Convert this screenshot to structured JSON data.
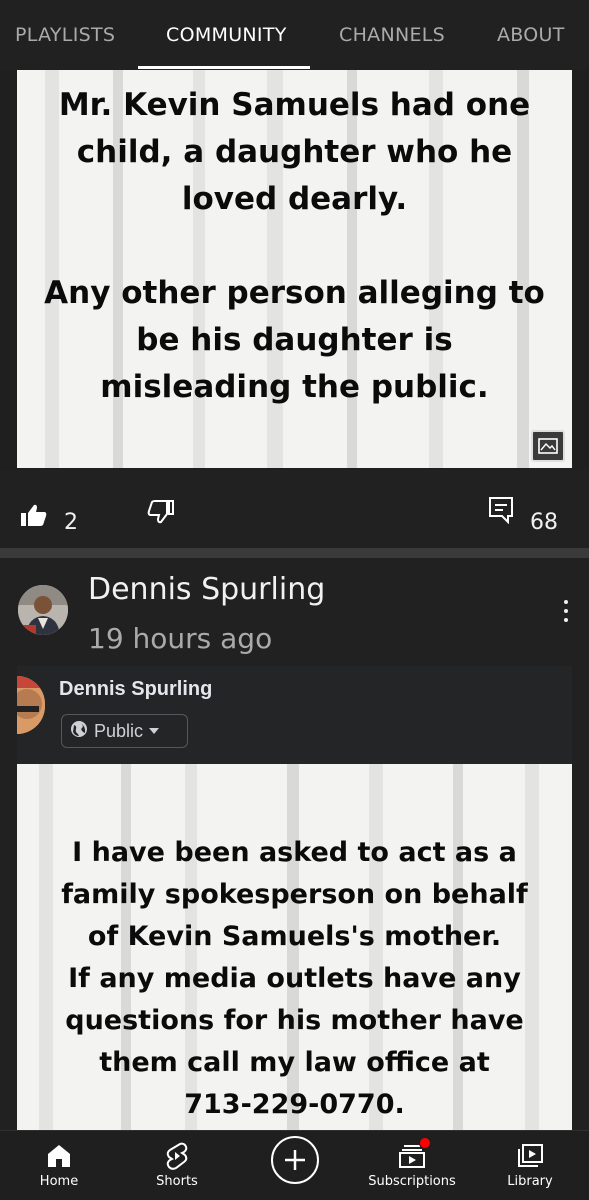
{
  "tabs": {
    "playlists": "PLAYLISTS",
    "community": "COMMUNITY",
    "channels": "CHANNELS",
    "about": "ABOUT",
    "active": "community"
  },
  "post1": {
    "image_text_lines": [
      "Mr. Kevin Samuels had one",
      "child, a daughter who he",
      "loved dearly.",
      "",
      "Any other person alleging to",
      "be his daughter is",
      "misleading the public."
    ],
    "image_badge_icon": "image-icon",
    "likes": "2",
    "comments": "68"
  },
  "post2": {
    "author": "Dennis Spurling",
    "time": "19 hours ago",
    "embed": {
      "name": "Dennis Spurling",
      "audience": "Public",
      "audience_icon": "globe-icon"
    },
    "image_text_lines": [
      "I have been asked to act as a",
      "family spokesperson on behalf",
      "of Kevin Samuels's mother.",
      "If any media outlets have any",
      "questions for his mother have",
      "them call my law office at",
      "713-229-0770."
    ]
  },
  "bottom_nav": {
    "home": "Home",
    "shorts": "Shorts",
    "subscriptions": "Subscriptions",
    "library": "Library"
  },
  "colors": {
    "background": "#212121",
    "accent_notification": "#ff0000",
    "post_image_bg": "#f3f3f1"
  }
}
